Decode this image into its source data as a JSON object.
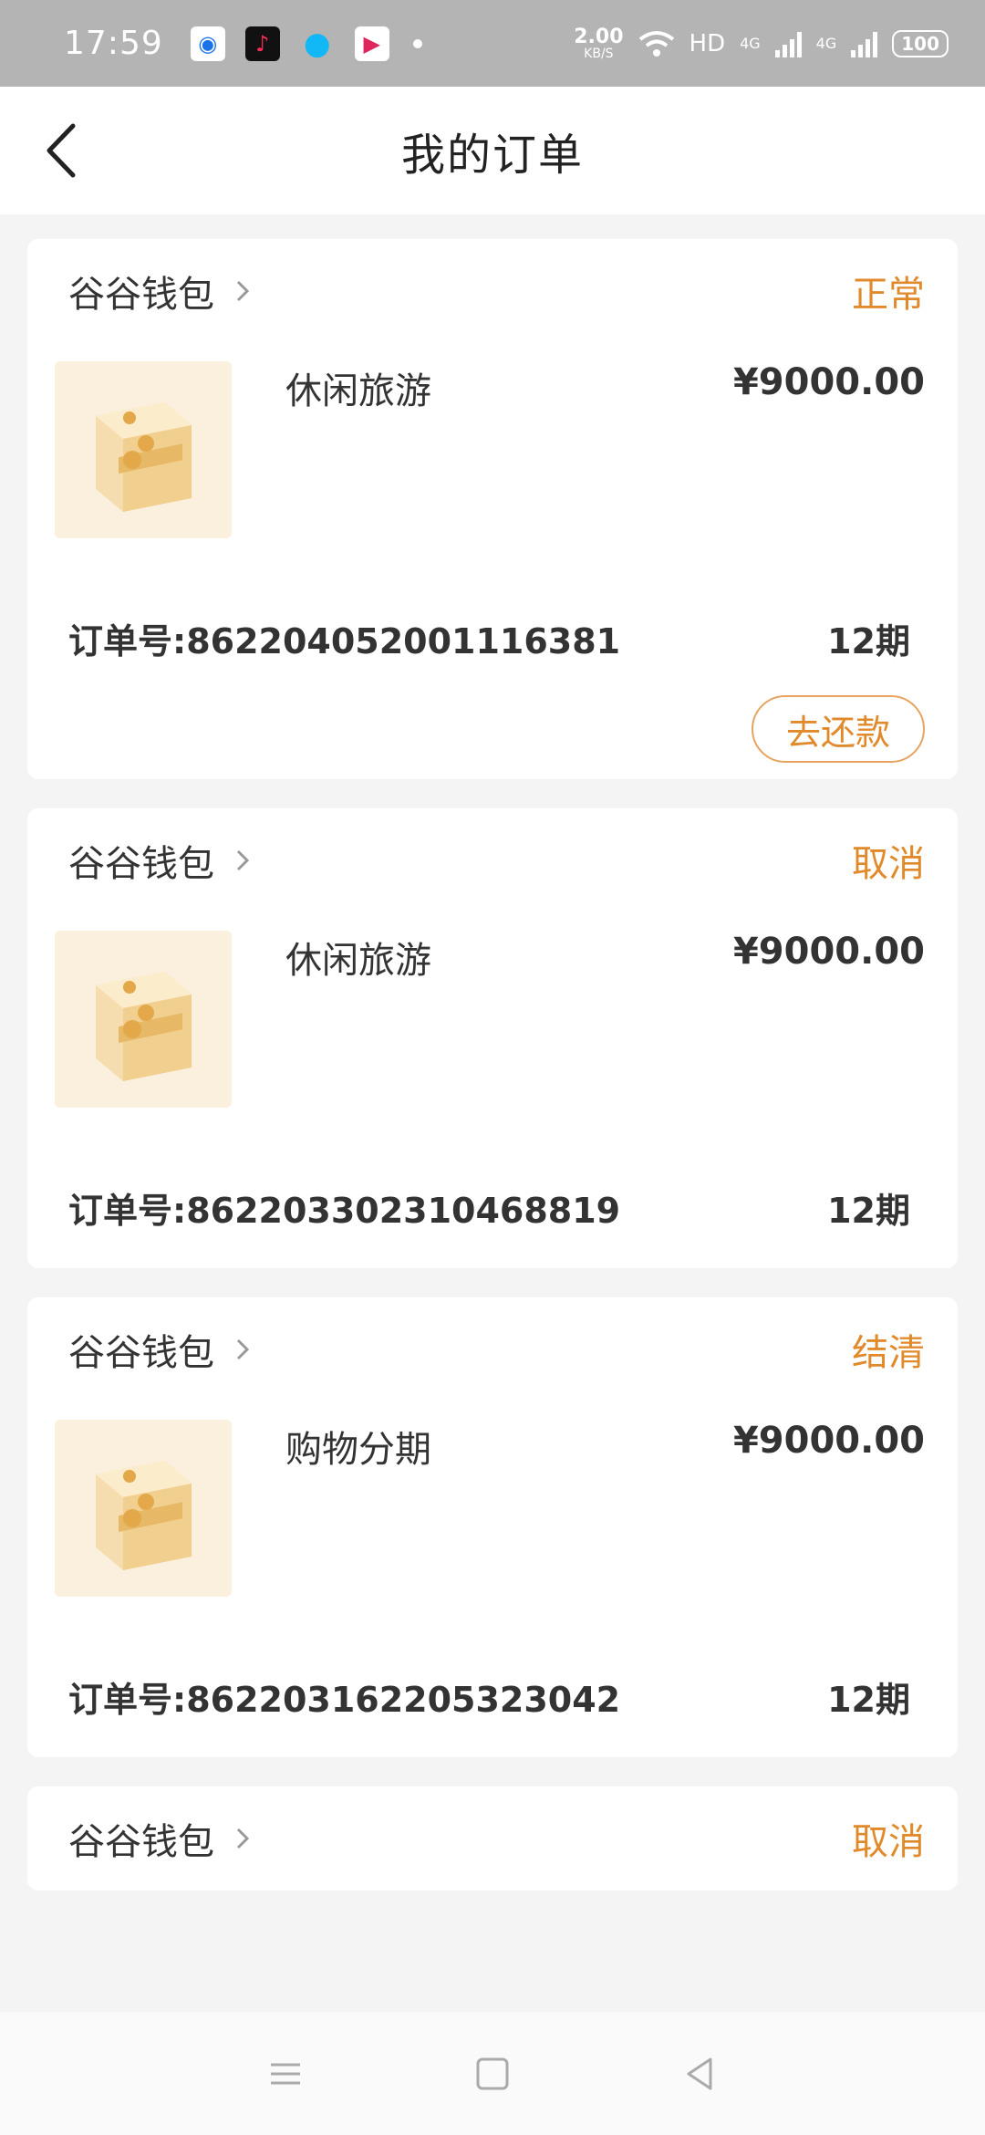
{
  "status_bar": {
    "time": "17:59",
    "net_speed_value": "2.00",
    "net_speed_unit": "KB/S",
    "hd_label": "HD",
    "signal1": "4G",
    "signal2": "4G",
    "battery": "100"
  },
  "header": {
    "title": "我的订单"
  },
  "orders": [
    {
      "shop": "谷谷钱包",
      "status": "正常",
      "product": "休闲旅游",
      "price": "¥9000.00",
      "order_no": "订单号:862204052001116381",
      "period": "12期",
      "action": "去还款"
    },
    {
      "shop": "谷谷钱包",
      "status": "取消",
      "product": "休闲旅游",
      "price": "¥9000.00",
      "order_no": "订单号:862203302310468819",
      "period": "12期"
    },
    {
      "shop": "谷谷钱包",
      "status": "结清",
      "product": "购物分期",
      "price": "¥9000.00",
      "order_no": "订单号:862203162205323042",
      "period": "12期"
    },
    {
      "shop": "谷谷钱包",
      "status": "取消"
    }
  ],
  "colors": {
    "accent": "#e08a2c",
    "status_bar_bg": "#b4b4b4"
  }
}
